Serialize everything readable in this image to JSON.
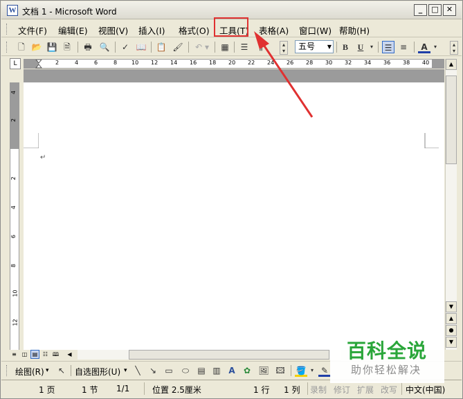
{
  "window": {
    "title": "文档 1 - Microsoft Word",
    "icon": "word-doc-icon",
    "minimize": "_",
    "maximize": "□",
    "close": "✕"
  },
  "menu": {
    "items": [
      {
        "label": "文件(F)"
      },
      {
        "label": "编辑(E)"
      },
      {
        "label": "视图(V)"
      },
      {
        "label": "插入(I)"
      },
      {
        "label": "格式(O)"
      },
      {
        "label": "工具(T)"
      },
      {
        "label": "表格(A)"
      },
      {
        "label": "窗口(W)"
      },
      {
        "label": "帮助(H)"
      }
    ],
    "highlighted": "工具(T)",
    "highlight_color": "#e03131"
  },
  "toolbar": {
    "font_size": "五号",
    "bold": "B",
    "underline": "U",
    "font_color_label": "A",
    "font_color": "#1f3ea8"
  },
  "ruler": {
    "corner": "L",
    "h_numbers": [
      "2",
      "2",
      "4",
      "6",
      "8",
      "10",
      "12",
      "14",
      "16",
      "18",
      "20",
      "22",
      "24",
      "26",
      "28",
      "30",
      "32",
      "34",
      "36",
      "38",
      "40"
    ],
    "v_numbers": [
      "4",
      "2",
      "2",
      "2",
      "4",
      "6",
      "8",
      "10",
      "12"
    ]
  },
  "doc": {
    "paragraph_mark": "↵"
  },
  "drawing_toolbar": {
    "draw_label": "绘图(R)",
    "autoshape_label": "自选图形(U)"
  },
  "status": {
    "page": "1 页",
    "section": "1 节",
    "pages": "1/1",
    "position": "位置 2.5厘米",
    "line": "1 行",
    "column": "1 列",
    "rec": "录制",
    "trk": "修订",
    "ext": "扩展",
    "ovr": "改写",
    "lang": "中文(中国)"
  },
  "watermark": {
    "main": "百科全说",
    "sub": "助你轻松解决"
  }
}
